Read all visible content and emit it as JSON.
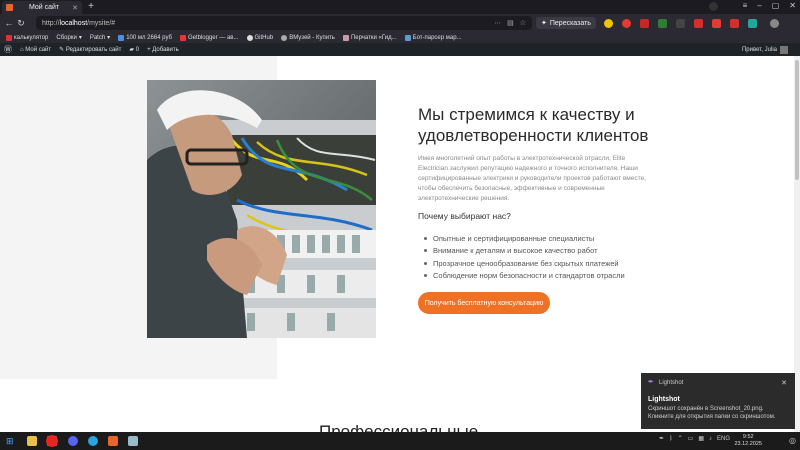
{
  "browser": {
    "tab_title": "Мой сайт",
    "url_prefix": "http://",
    "url_host": "localhost",
    "url_path": "/mysite/#",
    "translate_label": "Пересказать"
  },
  "bookmarks": [
    "калькулятор",
    "Сборки",
    "Patch",
    "100 мл 2664 руб",
    "Getblogger — ав...",
    "GitHub",
    "ВМузей - Купить",
    "Перчатки «Гид...",
    "Бот-парсер мар..."
  ],
  "admin_bar": {
    "site_name": "Мой сайт",
    "edit_site": "Редактировать сайт",
    "comments_count": "0",
    "add_new": "Добавить",
    "greeting": "Привет, Julia"
  },
  "section": {
    "title": "Мы стремимся к качеству и удовлетворенности клиентов",
    "description": "Имея многолетний опыт работы в электротехнической отрасли, Elite Electrician заслужил репутацию надежного и точного исполнителя. Наши сертифицированные электрики и руководители проектов работают вместе, чтобы обеспечить безопасные, эффективные и современные электротехнические решения.",
    "why_heading": "Почему выбирают нас?",
    "benefits": [
      "Опытные и сертифицированные специалисты",
      "Внимание к деталям и высокое качество работ",
      "Прозрачное ценообразование без скрытых платежей",
      "Соблюдение норм безопасности и стандартов отрасли"
    ],
    "cta_label": "Получить бесплатную консультацию",
    "next_heading": "Профессиональные"
  },
  "notification": {
    "app": "Lightshot",
    "title": "Lightshot",
    "line1": "Скриншот сохранён в Screenshot_20.png.",
    "line2": "Кликните для открытия папки со скриншотом."
  },
  "taskbar": {
    "lang": "ENG",
    "time": "9:52",
    "date": "23.12.2025"
  },
  "colors": {
    "accent": "#ef7125",
    "admin_bar": "#1d2327",
    "browser_chrome": "#2b2a33"
  }
}
